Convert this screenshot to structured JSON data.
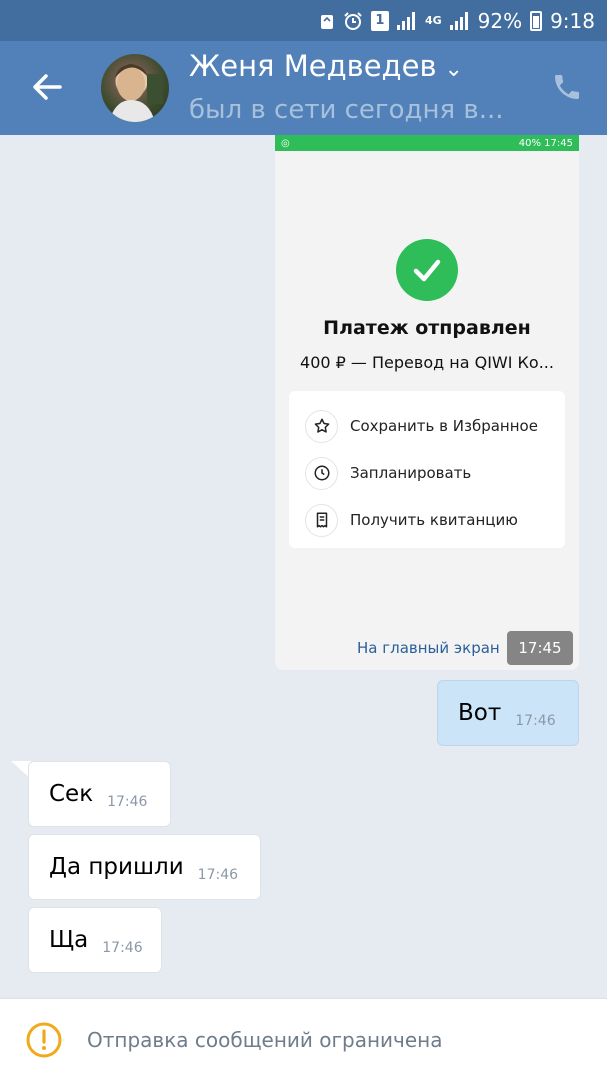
{
  "status_bar": {
    "battery": "92%",
    "time": "9:18",
    "sim_label": "1",
    "network": "4G"
  },
  "header": {
    "contact_name": "Женя Медведев",
    "contact_status": "был в сети сегодня в...",
    "icons": [
      "back-arrow-icon",
      "phone-icon",
      "chevron-down-icon"
    ]
  },
  "image_message": {
    "inner_status": {
      "time": "17:45",
      "battery": "40%"
    },
    "payment_title": "Платеж отправлен",
    "payment_subtitle": "400 ₽ — Перевод на QIWI Ко...",
    "actions": [
      {
        "label": "Сохранить в Избранное",
        "icon": "star-icon"
      },
      {
        "label": "Запланировать",
        "icon": "clock-icon"
      },
      {
        "label": "Получить квитанцию",
        "icon": "receipt-icon"
      }
    ],
    "home_link": "На главный экран",
    "time": "17:45",
    "accent_color": "#2fbd5a"
  },
  "messages": [
    {
      "direction": "out",
      "text": "Вот",
      "time": "17:46"
    },
    {
      "direction": "in",
      "text": "Сек",
      "time": "17:46"
    },
    {
      "direction": "in",
      "text": "Да пришли",
      "time": "17:46"
    },
    {
      "direction": "in",
      "text": "Ща",
      "time": "17:46"
    }
  ],
  "footer": {
    "notice": "Отправка сообщений ограничена",
    "icon": "warning-icon",
    "icon_color": "#f0a91a"
  },
  "colors": {
    "header_bg": "#5181b8",
    "status_bar_bg": "#416e9e",
    "chat_bg": "#e6ebf2",
    "outgoing_bubble": "#cce4f7",
    "incoming_bubble": "#ffffff"
  }
}
